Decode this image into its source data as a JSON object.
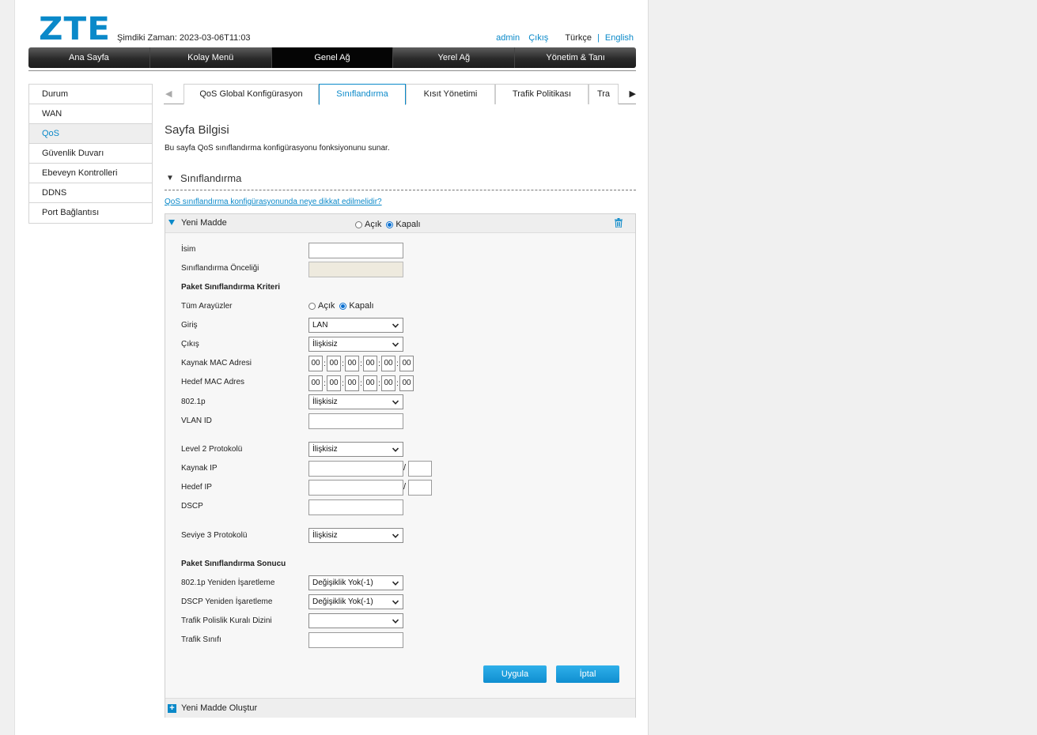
{
  "header": {
    "logo": "ZTE",
    "current_time": "Şimdiki Zaman: 2023-03-06T11:03",
    "user": "admin",
    "logout": "Çıkış",
    "lang_tr": "Türkçe",
    "lang_sep": "|",
    "lang_en": "English"
  },
  "nav": [
    {
      "label": "Ana Sayfa",
      "active": false
    },
    {
      "label": "Kolay Menü",
      "active": false
    },
    {
      "label": "Genel Ağ",
      "active": true
    },
    {
      "label": "Yerel Ağ",
      "active": false
    },
    {
      "label": "Yönetim & Tanı",
      "active": false
    }
  ],
  "sidebar": [
    {
      "label": "Durum",
      "active": false
    },
    {
      "label": "WAN",
      "active": false
    },
    {
      "label": "QoS",
      "active": true
    },
    {
      "label": "Güvenlik Duvarı",
      "active": false
    },
    {
      "label": "Ebeveyn Kontrolleri",
      "active": false
    },
    {
      "label": "DDNS",
      "active": false
    },
    {
      "label": "Port Bağlantısı",
      "active": false
    }
  ],
  "tabs": [
    {
      "label": "QoS Global Konfigürasyon",
      "active": false
    },
    {
      "label": "Sınıflandırma",
      "active": true
    },
    {
      "label": "Kısıt Yönetimi",
      "active": false
    },
    {
      "label": "Trafik Politikası",
      "active": false
    },
    {
      "label": "Tra",
      "active": false
    }
  ],
  "tab_arrows": {
    "left": "◀",
    "right": "▶"
  },
  "info": {
    "title": "Sayfa Bilgisi",
    "desc": "Bu sayfa QoS sınıflandırma konfigürasyonu fonksiyonunu sunar."
  },
  "section": {
    "arrow": "▼",
    "title": "Sınıflandırma"
  },
  "help_link": "QoS sınıflandırma konfigürasyonunda neye dikkat edilmelidir?",
  "item": {
    "name": "Yeni Madde",
    "on": "Açık",
    "off": "Kapalı",
    "enabled": false
  },
  "form": {
    "isim_label": "İsim",
    "isim_value": "",
    "oncelik_label": "Sınıflandırma Önceliği",
    "criteria_title": "Paket Sınıflandırma Kriteri",
    "all_if_label": "Tüm Arayüzler",
    "all_if_on": "Açık",
    "all_if_off": "Kapalı",
    "giris_label": "Giriş",
    "giris_value": "LAN",
    "cikis_label": "Çıkış",
    "cikis_value": "İlişkisiz",
    "src_mac_label": "Kaynak MAC Adresi",
    "src_mac": [
      "00",
      "00",
      "00",
      "00",
      "00",
      "00"
    ],
    "dst_mac_label": "Hedef MAC Adres",
    "dst_mac": [
      "00",
      "00",
      "00",
      "00",
      "00",
      "00"
    ],
    "mac_sep": ":",
    "p8021_label": "802.1p",
    "p8021_value": "İlişkisiz",
    "vlan_label": "VLAN ID",
    "l2_label": "Level 2 Protokolü",
    "l2_value": "İlişkisiz",
    "src_ip_label": "Kaynak IP",
    "dst_ip_label": "Hedef IP",
    "ip_slash": "/",
    "dscp_label": "DSCP",
    "l3_label": "Seviye 3 Protokolü",
    "l3_value": "İlişkisiz",
    "result_title": "Paket Sınıflandırma Sonucu",
    "remark8021_label": "802.1p Yeniden İşaretleme",
    "remark8021_value": "Değişiklik Yok(-1)",
    "remark_dscp_label": "DSCP Yeniden İşaretleme",
    "remark_dscp_value": "Değişiklik Yok(-1)",
    "policy_label": "Trafik Polislik Kuralı Dizini",
    "policy_value": "",
    "class_label": "Trafik Sınıfı"
  },
  "buttons": {
    "apply": "Uygula",
    "cancel": "İptal"
  },
  "footer": {
    "plus": "+",
    "create": "Yeni Madde Oluştur"
  },
  "colors": {
    "accent": "#0a89c9",
    "button": "#1a9ddc"
  }
}
